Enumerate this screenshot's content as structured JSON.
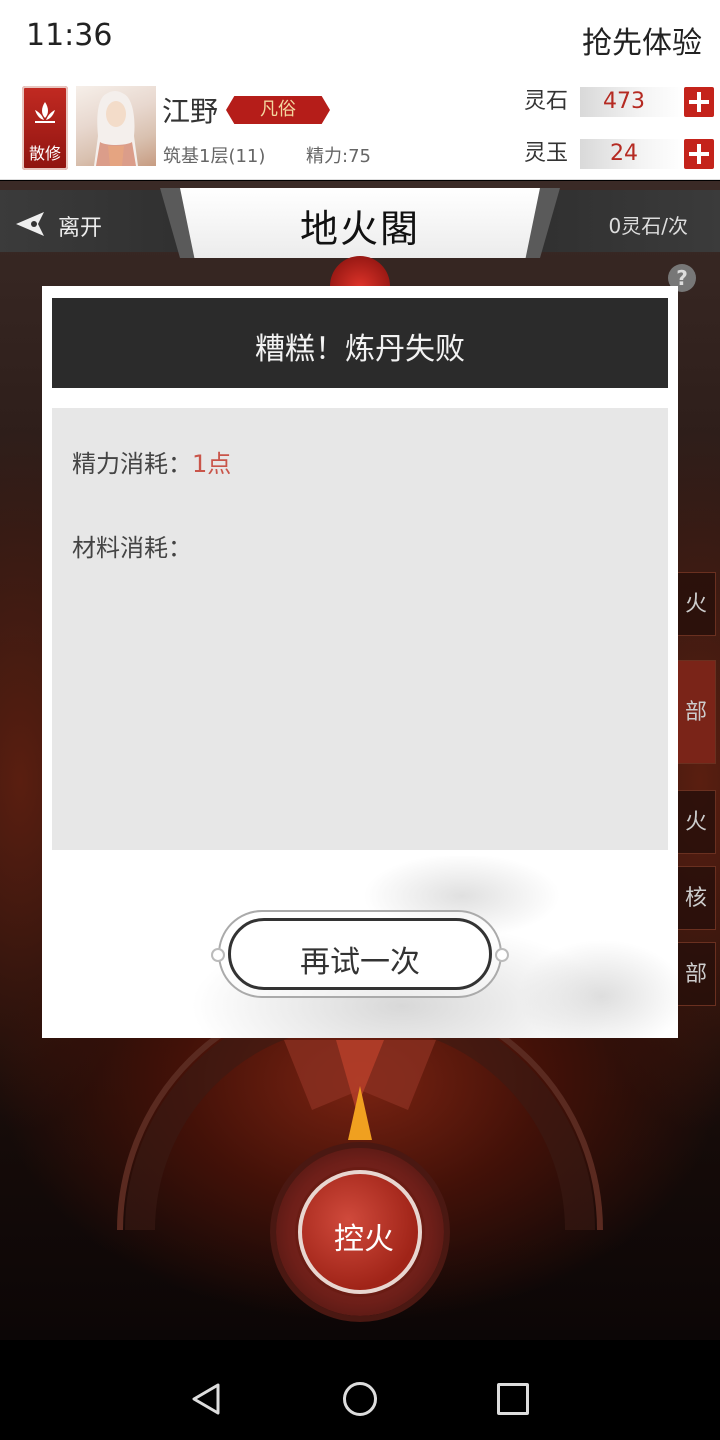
{
  "status_bar": {
    "time": "11:36",
    "right_label": "抢先体验"
  },
  "player": {
    "sect_label": "散修",
    "name": "江野",
    "rank": "凡俗",
    "realm": "筑基1层(11)",
    "energy": "精力:75"
  },
  "currencies": {
    "stone": {
      "label": "灵石",
      "value": "473"
    },
    "jade": {
      "label": "灵玉",
      "value": "24"
    }
  },
  "scene": {
    "leave_label": "离开",
    "title": "地火閣",
    "cost": "0灵石/次",
    "help_symbol": "?",
    "side_tabs": [
      "火",
      "部",
      "火",
      "核",
      "部"
    ],
    "fire_button": "控火"
  },
  "modal": {
    "title": "糟糕！炼丹失败",
    "energy_cost_label": "精力消耗：",
    "energy_cost_value": "1点",
    "material_cost_label": "材料消耗：",
    "retry_label": "再试一次"
  },
  "colors": {
    "accent_red": "#c4231b",
    "cost_value_red": "#c9554a",
    "modal_header_bg": "#2b2b2b"
  },
  "icons": [
    "lotus-icon",
    "leave-arrow-icon",
    "help-icon",
    "plus-icon",
    "nav-back-icon",
    "nav-home-icon",
    "nav-recent-icon"
  ]
}
